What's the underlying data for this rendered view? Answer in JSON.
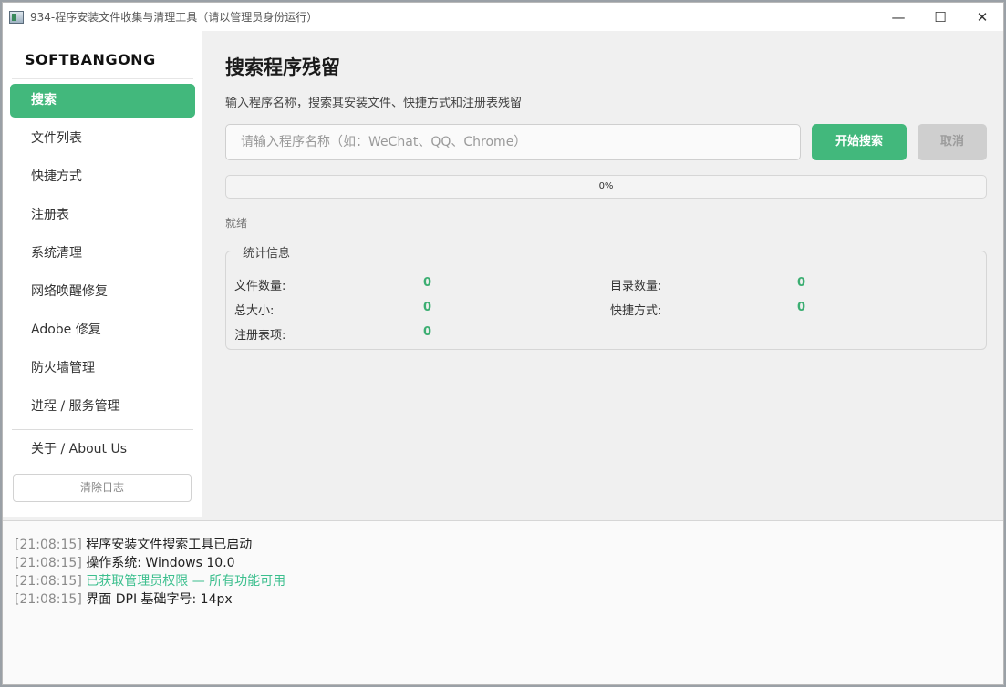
{
  "window": {
    "title": "934-程序安装文件收集与清理工具（请以管理员身份运行）",
    "controls": {
      "minimize": "—",
      "maximize": "☐",
      "close": "✕"
    }
  },
  "sidebar": {
    "brand": "SOFTBANGONG",
    "items": [
      {
        "label": "搜索",
        "active": true
      },
      {
        "label": "文件列表"
      },
      {
        "label": "快捷方式"
      },
      {
        "label": "注册表"
      },
      {
        "label": "系统清理"
      },
      {
        "label": "网络唤醒修复"
      },
      {
        "label": "Adobe 修复"
      },
      {
        "label": "防火墙管理"
      },
      {
        "label": "进程 / 服务管理"
      }
    ],
    "about": "关于 / About Us",
    "clear_log": "清除日志"
  },
  "main": {
    "title": "搜索程序残留",
    "subtitle": "输入程序名称，搜索其安装文件、快捷方式和注册表残留",
    "search_placeholder": "请输入程序名称（如：WeChat、QQ、Chrome）",
    "search_value": "",
    "start_button": "开始搜索",
    "cancel_button": "取消",
    "progress_percent": 0,
    "progress_text": "0%",
    "status": "就绪"
  },
  "stats": {
    "legend": "统计信息",
    "file_count_label": "文件数量:",
    "file_count": "0",
    "dir_count_label": "目录数量:",
    "dir_count": "0",
    "total_size_label": "总大小:",
    "total_size": "0",
    "shortcut_label": "快捷方式:",
    "shortcut_count": "0",
    "registry_label": "注册表项:",
    "registry_count": "0"
  },
  "log": [
    {
      "time": "[21:08:15]",
      "message": "程序安装文件搜索工具已启动",
      "type": "info"
    },
    {
      "time": "[21:08:15]",
      "message": "操作系统: Windows 10.0",
      "type": "info"
    },
    {
      "time": "[21:08:15]",
      "message": "已获取管理员权限 — 所有功能可用",
      "type": "ok"
    },
    {
      "time": "[21:08:15]",
      "message": "界面 DPI 基础字号: 14px",
      "type": "info"
    }
  ],
  "colors": {
    "accent": "#42b87c",
    "value": "#3cae72",
    "log_ok": "#3cbf8e"
  }
}
